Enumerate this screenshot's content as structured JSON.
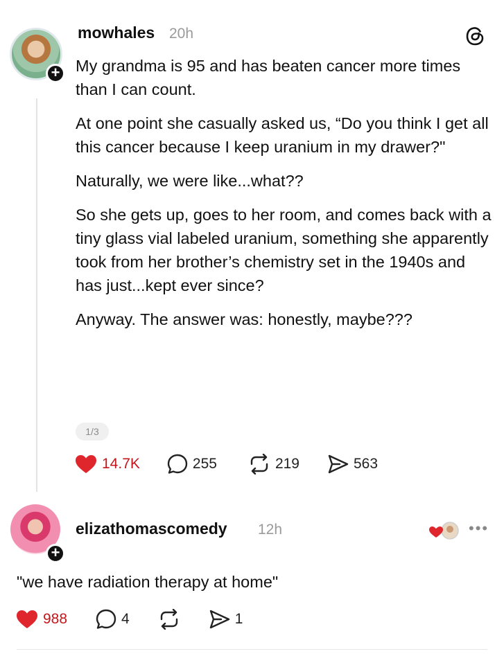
{
  "post1": {
    "username": "mowhales",
    "time": "20h",
    "paragraphs": [
      "My grandma is 95 and has beaten cancer more times than I can count.",
      "At one point she casually asked us, “Do you think I get all this cancer because I keep uranium in my drawer?\"",
      "Naturally, we were like...what??",
      "So she gets up, goes to her room, and comes back with a tiny glass vial labeled uranium, something she apparently took from her brother’s chemistry set in the 1940s and has just...kept ever since?",
      "Anyway. The answer was: honestly, maybe???"
    ],
    "pager": "1/3",
    "likes": "14.7K",
    "comments": "255",
    "reposts": "219",
    "shares": "563"
  },
  "post2": {
    "username": "elizathomascomedy",
    "time": "12h",
    "text": "\"we have radiation therapy at home\"",
    "likes": "988",
    "comments": "4",
    "reposts": "",
    "shares": "1"
  },
  "icons": {
    "like": "heart-filled-icon",
    "comment": "speech-bubble-icon",
    "repost": "repost-arrows-icon",
    "share": "paper-plane-icon",
    "brand": "threads-logo-icon",
    "more": "more-dots-icon"
  },
  "colors": {
    "like": "#e0262d",
    "text": "#111111",
    "muted": "#9a9a9a"
  }
}
